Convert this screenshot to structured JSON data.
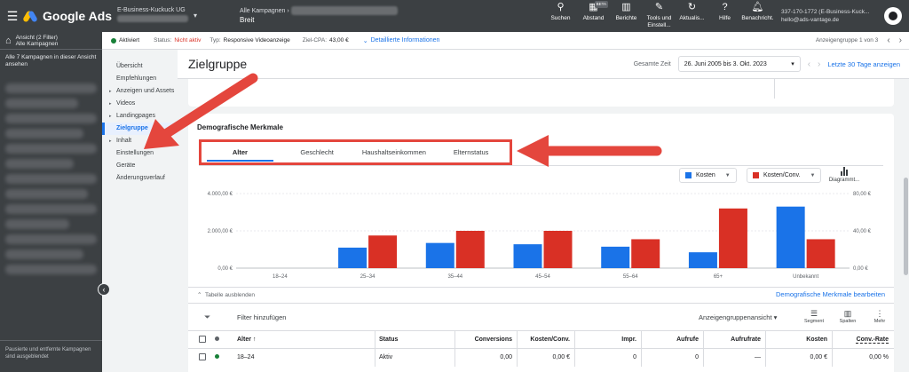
{
  "topbar": {
    "app_name": "Google Ads",
    "account_name": "E-Business-Kuckuck UG",
    "campaign_label": "Alle Kampagnen",
    "campaign_sub": "Breit",
    "tools": [
      {
        "label": "Suchen",
        "icon": "search-icon"
      },
      {
        "label": "Abstand",
        "icon": "spacing-icon",
        "badge": "BETA"
      },
      {
        "label": "Berichte",
        "icon": "reports-icon"
      },
      {
        "label": "Tools und Einstell...",
        "icon": "tools-icon"
      },
      {
        "label": "Aktualis...",
        "icon": "refresh-icon"
      },
      {
        "label": "Hilfe",
        "icon": "help-icon"
      },
      {
        "label": "Benachricht.",
        "icon": "bell-icon"
      }
    ],
    "user_id": "337-170-1772 (E-Business-Kuck...",
    "user_email": "hello@ads-vantage.de"
  },
  "leftnav": {
    "view_label": "Ansicht (2 Filter)",
    "view_value": "Alle Kampagnen",
    "all_label": "Alle 7 Kampagnen in dieser Ansicht ansehen",
    "footer": "Pausierte und entfernte Kampagnen sind ausgeblendet"
  },
  "statusbar": {
    "status": "Aktiviert",
    "status_label": "Status:",
    "status_value": "Nicht aktiv",
    "type_label": "Typ:",
    "type_value": "Responsive Videoanzeige",
    "cpa_label": "Ziel-CPA:",
    "cpa_value": "43,00 €",
    "details": "Detaillierte Informationen",
    "pager": "Anzeigengruppe 1 von 3",
    "colors": {
      "status_active": "#188038",
      "status_inactive": "#d93025"
    }
  },
  "subnav": [
    {
      "label": "Übersicht",
      "expand": false,
      "active": false
    },
    {
      "label": "Empfehlungen",
      "expand": false,
      "active": false
    },
    {
      "label": "Anzeigen und Assets",
      "expand": true,
      "active": false
    },
    {
      "label": "Videos",
      "expand": true,
      "active": false
    },
    {
      "label": "Landingpages",
      "expand": true,
      "active": false
    },
    {
      "label": "Zielgruppe",
      "expand": false,
      "active": true
    },
    {
      "label": "Inhalt",
      "expand": true,
      "active": false
    },
    {
      "label": "Einstellungen",
      "expand": false,
      "active": false
    },
    {
      "label": "Geräte",
      "expand": false,
      "active": false
    },
    {
      "label": "Änderungsverlauf",
      "expand": false,
      "active": false
    }
  ],
  "main": {
    "title": "Zielgruppe",
    "range_label": "Gesamte Zeit",
    "range_value": "26. Juni 2005 bis 3. Okt. 2023",
    "last30": "Letzte 30 Tage anzeigen"
  },
  "card": {
    "title": "Demografische Merkmale",
    "tabs": [
      "Alter",
      "Geschlecht",
      "Haushaltseinkommen",
      "Elternstatus"
    ],
    "active_tab": 0,
    "metric1": "Kosten",
    "metric2": "Kosten/Conv.",
    "chart_button": "Diagrammt...",
    "colors": {
      "series1": "#1a73e8",
      "series2": "#d93025",
      "annotation": "#e4463d"
    }
  },
  "chart_data": {
    "type": "bar",
    "categories": [
      "18–24",
      "25–34",
      "35–44",
      "45–54",
      "55–64",
      "65+",
      "Unbekannt"
    ],
    "series": [
      {
        "name": "Kosten",
        "axis": "left",
        "values": [
          0,
          1100,
          1350,
          1280,
          1150,
          850,
          3300
        ]
      },
      {
        "name": "Kosten/Conv.",
        "axis": "right",
        "values": [
          0,
          35,
          40,
          40,
          31,
          64,
          31
        ]
      }
    ],
    "y_left_ticks": [
      "0,00 €",
      "2.000,00 €",
      "4.000,00 €"
    ],
    "y_right_ticks": [
      "0,00 €",
      "40,00 €",
      "80,00 €"
    ],
    "ylim_left": [
      0,
      4000
    ],
    "ylim_right": [
      0,
      80
    ],
    "grid": true,
    "legend": "top-right"
  },
  "table": {
    "hide_label": "Tabelle ausblenden",
    "edit_label": "Demografische Merkmale bearbeiten",
    "filter_label": "Filter hinzufügen",
    "view_label": "Anzeigengruppenansicht",
    "toolbar": [
      "Segment",
      "Spalten",
      "Mehr"
    ],
    "headers": [
      "Alter",
      "Status",
      "Conversions",
      "Kosten/Conv.",
      "Impr.",
      "Aufrufe",
      "Aufrufrate",
      "Kosten",
      "Conv.-Rate"
    ],
    "rows": [
      {
        "age": "18–24",
        "status": "Aktiv",
        "conversions": "0,00",
        "cpa": "0,00 €",
        "impr": "0",
        "views": "0",
        "view_rate": "—",
        "cost": "0,00 €",
        "conv_rate": "0,00 %"
      }
    ]
  }
}
